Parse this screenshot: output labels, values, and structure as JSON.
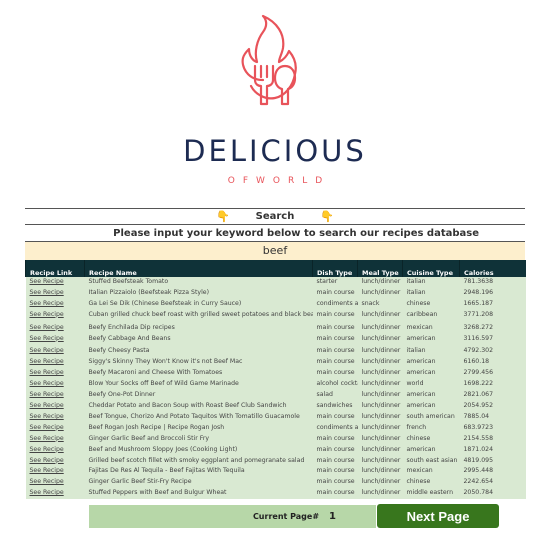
{
  "brand": {
    "title": "DELICIOUS",
    "subtitle": "OFWORLD",
    "logo_icon": "flame-fork-spoon-icon",
    "colors": {
      "title": "#1d2b52",
      "accent": "#e8535a"
    }
  },
  "search": {
    "label": "Search",
    "hand_icon": "👇",
    "prompt": "Please input your keyword below to search our recipes database",
    "keyword": "beef"
  },
  "table": {
    "columns": [
      "Recipe Link",
      "Recipe Name",
      "Dish Type",
      "Meal Type",
      "Cuisine Type",
      "Calories"
    ],
    "rows": [
      {
        "link": "See Recipe",
        "name": "Stuffed Beefsteak Tomato",
        "dish": "starter",
        "meal": "lunch/dinner",
        "cuisine": "italian",
        "calories": "781.3638"
      },
      {
        "link": "See Recipe",
        "name": "Italian Pizzaiolo (Beefsteak Pizza Style)",
        "dish": "main course",
        "meal": "lunch/dinner",
        "cuisine": "italian",
        "calories": "2948.196"
      },
      {
        "link": "See Recipe",
        "name": "Ga Lei Se Dik (Chinese Beefsteak in Curry Sauce)",
        "dish": "condiments and sauces",
        "meal": "snack",
        "cuisine": "chinese",
        "calories": "1665.187"
      },
      {
        "link": "See Recipe",
        "name": "Cuban grilled chuck beef roast with grilled sweet potatoes and black beans",
        "dish": "main course",
        "meal": "lunch/dinner",
        "cuisine": "caribbean",
        "calories": "3771.208"
      },
      {
        "link": "See Recipe",
        "name": "Beefy Enchilada Dip recipes",
        "dish": "main course",
        "meal": "lunch/dinner",
        "cuisine": "mexican",
        "calories": "3268.272"
      },
      {
        "link": "See Recipe",
        "name": "Beefy Cabbage And Beans",
        "dish": "main course",
        "meal": "lunch/dinner",
        "cuisine": "american",
        "calories": "3116.597"
      },
      {
        "link": "See Recipe",
        "name": "Beefy Cheesy Pasta",
        "dish": "main course",
        "meal": "lunch/dinner",
        "cuisine": "italian",
        "calories": "4792.302"
      },
      {
        "link": "See Recipe",
        "name": "Siggy's Skinny They Won't Know it's not Beef Mac",
        "dish": "main course",
        "meal": "lunch/dinner",
        "cuisine": "american",
        "calories": "6160.18"
      },
      {
        "link": "See Recipe",
        "name": "Beefy Macaroni and Cheese With Tomatoes",
        "dish": "main course",
        "meal": "lunch/dinner",
        "cuisine": "american",
        "calories": "2799.456"
      },
      {
        "link": "See Recipe",
        "name": "Blow Your Socks off Beef of Wild Game Marinade",
        "dish": "alcohol cocktail",
        "meal": "lunch/dinner",
        "cuisine": "world",
        "calories": "1698.222"
      },
      {
        "link": "See Recipe",
        "name": "Beefy One-Pot Dinner",
        "dish": "salad",
        "meal": "lunch/dinner",
        "cuisine": "american",
        "calories": "2821.067"
      },
      {
        "link": "See Recipe",
        "name": "Cheddar Potato and Bacon Soup with Roast Beef Club Sandwich",
        "dish": "sandwiches",
        "meal": "lunch/dinner",
        "cuisine": "american",
        "calories": "2054.952"
      },
      {
        "link": "See Recipe",
        "name": "Beef Tongue, Chorizo And Potato Taquitos With Tomatillo Guacamole",
        "dish": "main course",
        "meal": "lunch/dinner",
        "cuisine": "south american",
        "calories": "7885.04"
      },
      {
        "link": "See Recipe",
        "name": "Beef Rogan Josh Recipe | Recipe Rogan Josh",
        "dish": "condiments and sauces",
        "meal": "lunch/dinner",
        "cuisine": "french",
        "calories": "683.9723"
      },
      {
        "link": "See Recipe",
        "name": "Ginger Garlic Beef and Broccoli Stir Fry",
        "dish": "main course",
        "meal": "lunch/dinner",
        "cuisine": "chinese",
        "calories": "2154.558"
      },
      {
        "link": "See Recipe",
        "name": "Beef and Mushroom Sloppy Joes (Cooking Light)",
        "dish": "main course",
        "meal": "lunch/dinner",
        "cuisine": "american",
        "calories": "1871.024"
      },
      {
        "link": "See Recipe",
        "name": "Grilled beef scotch fillet with smoky eggplant and pomegranate salad",
        "dish": "main course",
        "meal": "lunch/dinner",
        "cuisine": "south east asian",
        "calories": "4819.095"
      },
      {
        "link": "See Recipe",
        "name": "Fajitas De Res Al Tequila - Beef Fajitas With Tequila",
        "dish": "main course",
        "meal": "lunch/dinner",
        "cuisine": "mexican",
        "calories": "2995.448"
      },
      {
        "link": "See Recipe",
        "name": "Ginger Garlic Beef Stir-Fry Recipe",
        "dish": "main course",
        "meal": "lunch/dinner",
        "cuisine": "chinese",
        "calories": "2242.654"
      },
      {
        "link": "See Recipe",
        "name": "Stuffed Peppers with Beef and Bulgur Wheat",
        "dish": "main course",
        "meal": "lunch/dinner",
        "cuisine": "middle eastern",
        "calories": "2050.784"
      }
    ]
  },
  "pager": {
    "label": "Current Page#",
    "current_page": "1",
    "next_label": "Next  Page"
  }
}
